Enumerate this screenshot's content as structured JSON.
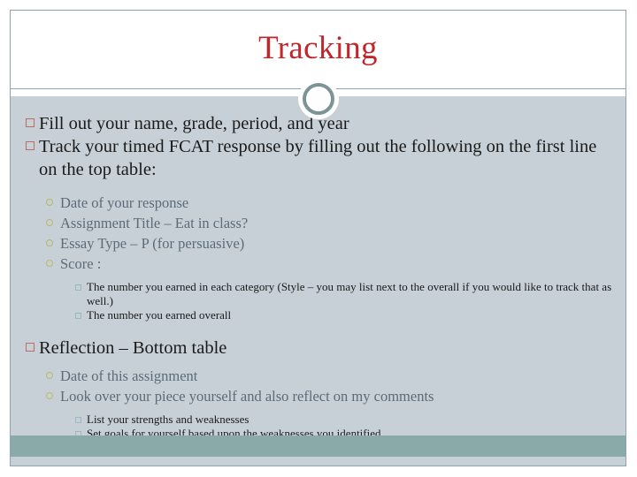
{
  "slide": {
    "title": "Tracking",
    "accent_title_color": "#c0262b",
    "body_background": "#c6d0d6",
    "footer_bar_color": "#8aa9a9",
    "ornament_color": "#7d9497",
    "level1_bullet_color": "#bb6e5e",
    "level2_bullet_color": "#b9b96a",
    "level3_bullet_color": "#9fb6c4",
    "level1_text_color": "#1a1a1a",
    "level2_text_color": "#5d6b78"
  },
  "content": {
    "item1": "Fill out your name, grade, period, and year",
    "item2": "Track your timed FCAT response by filling out the following on the first line on the top table:",
    "sub1": "Date of your response",
    "sub2": "Assignment Title – Eat in class?",
    "sub3": "Essay Type – P (for persuasive)",
    "sub4": "Score :",
    "sub4a": "The number you earned in each category (Style – you may list next to the overall if you would like to track that as well.)",
    "sub4b": "The number you earned overall",
    "item3": "Reflection – Bottom table",
    "sub5": "Date of this assignment",
    "sub6": "Look over your piece yourself and also reflect on my comments",
    "sub6a": "List your strengths and weaknesses",
    "sub6b": "Set goals for yourself based upon the weaknesses you identified"
  }
}
